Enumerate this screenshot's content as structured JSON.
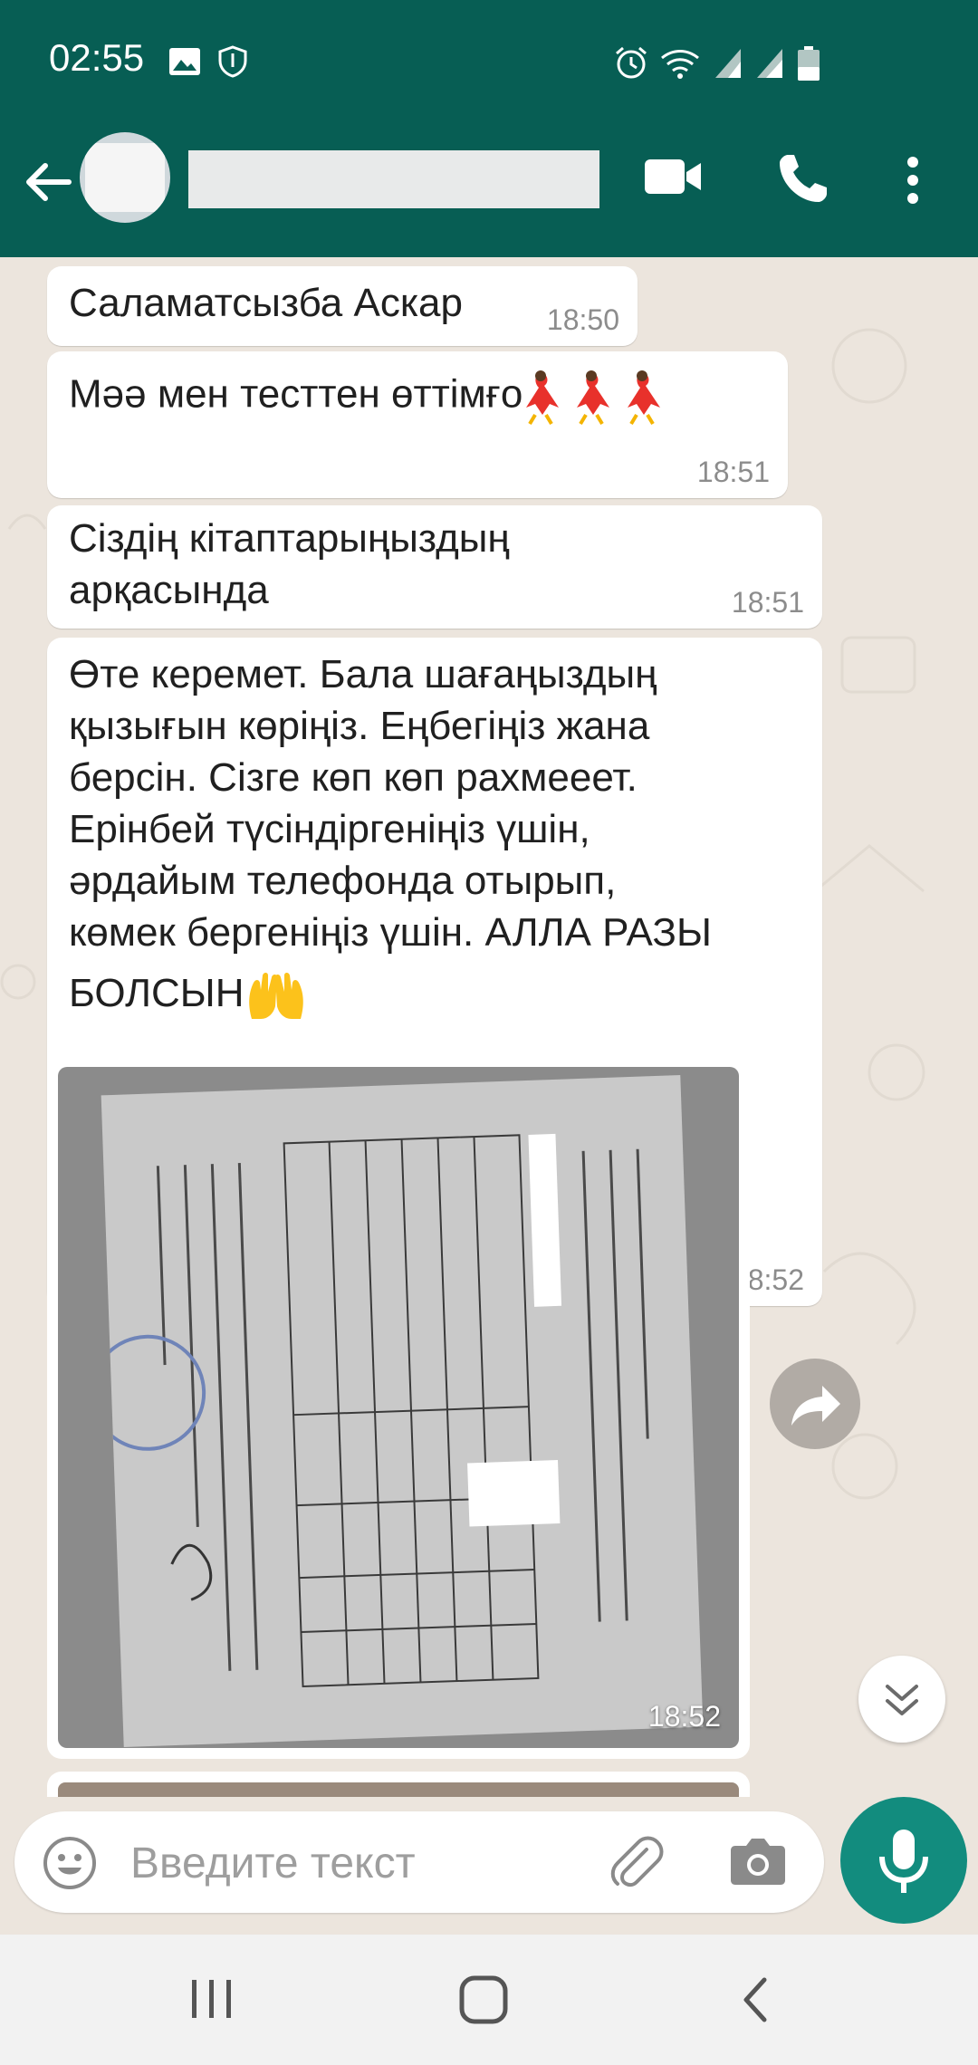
{
  "status_bar": {
    "time": "02:55",
    "icons": [
      "image-icon",
      "shield-icon",
      "alarm-icon",
      "wifi-icon",
      "signal-icon",
      "signal-icon",
      "battery-icon"
    ]
  },
  "header": {
    "contact_name": "",
    "icons": [
      "back-arrow-icon",
      "video-call-icon",
      "phone-icon",
      "more-vert-icon"
    ]
  },
  "messages": [
    {
      "text": "Саламатсызба Аскар",
      "time": "18:50"
    },
    {
      "text": "Мәә мен тесттен өттімғо",
      "emoji": "dancer-emoji",
      "time": "18:51"
    },
    {
      "lines": [
        "Сіздің кітаптарыңыздың",
        "арқасында"
      ],
      "time": "18:51"
    },
    {
      "lines": [
        "Өте керемет. Бала шағаңыздың",
        "қызығын көріңіз. Еңбегіңіз жана",
        "берсін. Сізге көп көп рахмееет.",
        "Ерінбей түсіндіргеніңіз үшін,",
        "әрдайым телефонда отырып,",
        "көмек бергеніңіз үшін. АЛЛА РАЗЫ",
        "БОЛСЫН"
      ],
      "emoji": "raising-hands-emoji",
      "time": "18:52"
    },
    {
      "type": "image",
      "subject": "certificate-photo",
      "time": "18:52"
    }
  ],
  "input": {
    "placeholder": "Введите текст",
    "icons": [
      "emoji-icon",
      "attach-icon",
      "camera-icon",
      "mic-icon"
    ]
  },
  "nav_bar": {
    "icons": [
      "recents-icon",
      "home-icon",
      "back-icon"
    ]
  },
  "colors": {
    "header": "#075e54",
    "accent": "#128c7e",
    "bubble": "#ffffff",
    "chat_bg": "#ece5dd"
  }
}
